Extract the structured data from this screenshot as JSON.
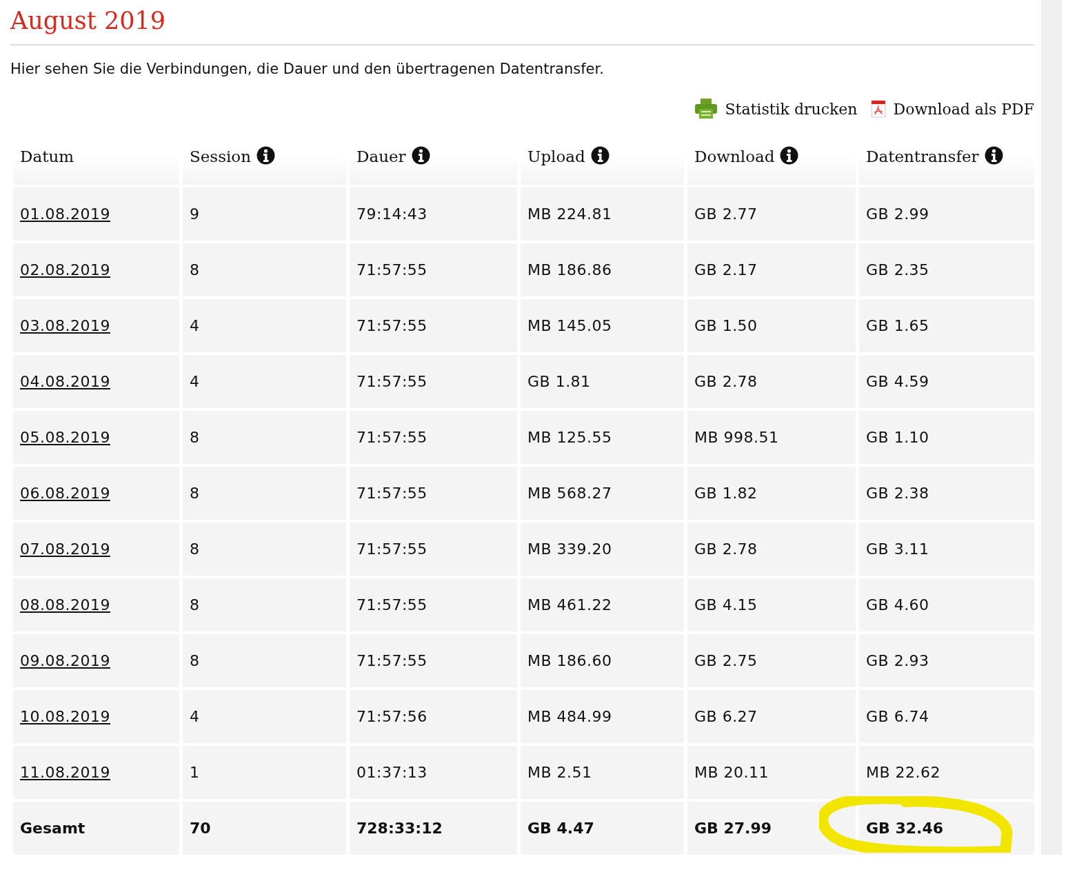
{
  "title": "August 2019",
  "intro": "Hier sehen Sie die Verbindungen, die Dauer und den übertragenen Datentransfer.",
  "actions": [
    {
      "kind": "print",
      "label": "Statistik drucken"
    },
    {
      "kind": "pdf",
      "label": "Download als PDF"
    }
  ],
  "table": {
    "columns": [
      {
        "label": "Datum",
        "info": false
      },
      {
        "label": "Session",
        "info": true
      },
      {
        "label": "Dauer",
        "info": true
      },
      {
        "label": "Upload",
        "info": true
      },
      {
        "label": "Download",
        "info": true
      },
      {
        "label": "Datentransfer",
        "info": true
      }
    ],
    "rows": [
      [
        "01.08.2019",
        "9",
        "79:14:43",
        "MB 224.81",
        "GB 2.77",
        "GB 2.99"
      ],
      [
        "02.08.2019",
        "8",
        "71:57:55",
        "MB 186.86",
        "GB 2.17",
        "GB 2.35"
      ],
      [
        "03.08.2019",
        "4",
        "71:57:55",
        "MB 145.05",
        "GB 1.50",
        "GB 1.65"
      ],
      [
        "04.08.2019",
        "4",
        "71:57:55",
        "GB 1.81",
        "GB 2.78",
        "GB 4.59"
      ],
      [
        "05.08.2019",
        "8",
        "71:57:55",
        "MB 125.55",
        "MB 998.51",
        "GB 1.10"
      ],
      [
        "06.08.2019",
        "8",
        "71:57:55",
        "MB 568.27",
        "GB 1.82",
        "GB 2.38"
      ],
      [
        "07.08.2019",
        "8",
        "71:57:55",
        "MB 339.20",
        "GB 2.78",
        "GB 3.11"
      ],
      [
        "08.08.2019",
        "8",
        "71:57:55",
        "MB 461.22",
        "GB 4.15",
        "GB 4.60"
      ],
      [
        "09.08.2019",
        "8",
        "71:57:55",
        "MB 186.60",
        "GB 2.75",
        "GB 2.93"
      ],
      [
        "10.08.2019",
        "4",
        "71:57:56",
        "MB 484.99",
        "GB 6.27",
        "GB 6.74"
      ],
      [
        "11.08.2019",
        "1",
        "01:37:13",
        "MB 2.51",
        "MB 20.11",
        "MB 22.62"
      ]
    ],
    "total": [
      {
        "text": "Gesamt",
        "highlighted": false
      },
      {
        "text": "70",
        "highlighted": false
      },
      {
        "text": "728:33:12",
        "highlighted": false
      },
      {
        "text": "GB 4.47",
        "highlighted": false
      },
      {
        "text": "GB 27.99",
        "highlighted": false
      },
      {
        "text": "GB 32.46",
        "highlighted": true
      }
    ]
  }
}
